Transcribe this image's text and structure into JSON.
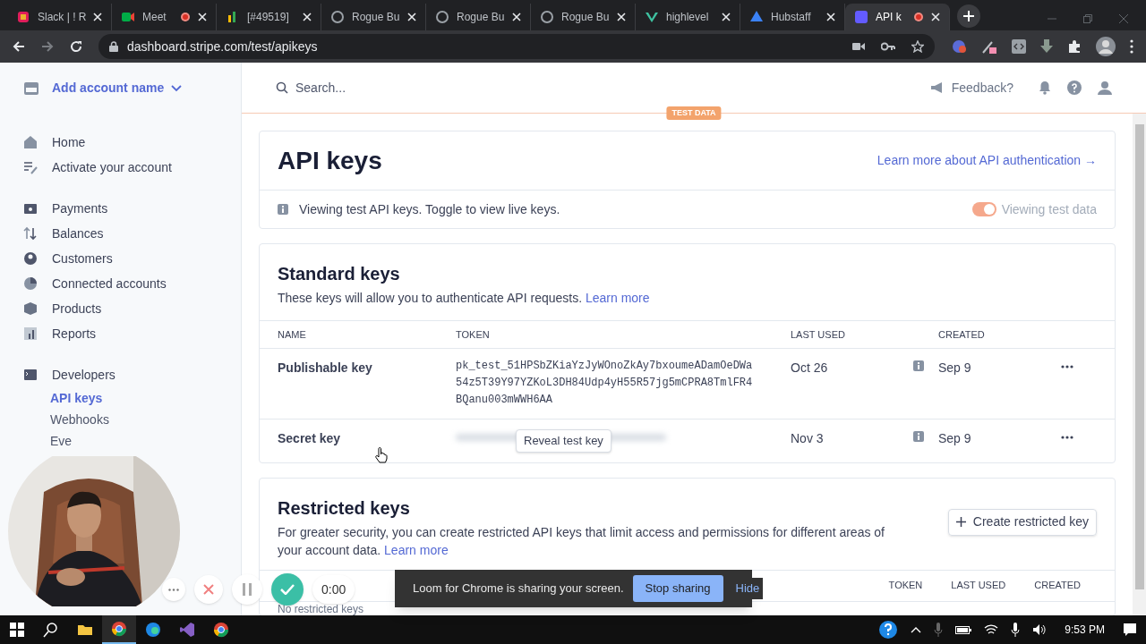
{
  "browser": {
    "tabs": [
      {
        "title": "Slack | ! R",
        "selected": false,
        "recording": false
      },
      {
        "title": "Meet",
        "selected": false,
        "recording": true
      },
      {
        "title": "[#49519]",
        "selected": false,
        "recording": false
      },
      {
        "title": "Rogue Bu",
        "selected": false,
        "recording": false
      },
      {
        "title": "Rogue Bu",
        "selected": false,
        "recording": false
      },
      {
        "title": "Rogue Bu",
        "selected": false,
        "recording": false
      },
      {
        "title": "highlevel",
        "selected": false,
        "recording": false
      },
      {
        "title": "Hubstaff",
        "selected": false,
        "recording": false
      },
      {
        "title": "API k",
        "selected": true,
        "recording": true
      }
    ],
    "url": "dashboard.stripe.com/test/apikeys"
  },
  "sidebar": {
    "account": "Add account name",
    "groups": [
      [
        {
          "label": "Home",
          "selected": false
        },
        {
          "label": "Activate your account",
          "selected": false
        }
      ],
      [
        {
          "label": "Payments",
          "selected": false
        },
        {
          "label": "Balances",
          "selected": false
        },
        {
          "label": "Customers",
          "selected": false
        },
        {
          "label": "Connected accounts",
          "selected": false
        },
        {
          "label": "Products",
          "selected": false
        },
        {
          "label": "Reports",
          "selected": false
        }
      ],
      [
        {
          "label": "Developers",
          "selected": false,
          "children": [
            {
              "label": "API keys",
              "selected": true
            },
            {
              "label": "Webhooks",
              "selected": false
            },
            {
              "label": "Eve",
              "selected": false
            }
          ]
        }
      ]
    ]
  },
  "header": {
    "search_placeholder": "Search...",
    "feedback": "Feedback?",
    "badge": "TEST DATA"
  },
  "page": {
    "title": "API keys",
    "auth_link": "Learn more about API authentication →",
    "notice": "Viewing test API keys. Toggle to view live keys.",
    "toggle": {
      "label": "Viewing test data",
      "on": true
    }
  },
  "standard_keys": {
    "title": "Standard keys",
    "description": "These keys will allow you to authenticate API requests.",
    "link": "Learn more",
    "columns": [
      "NAME",
      "TOKEN",
      "LAST USED",
      "CREATED"
    ],
    "rows": [
      {
        "kind": "visible",
        "name": "Publishable key",
        "token": "pk_test_51HPSbZKiaYzJyWOnoZkAy7bxoumeADamOeDWa54z5T39Y97YZKoL3DH84Udp4yH55R57jg5mCPRA8TmlFR4BQanu003mWWH6AA",
        "last_used": "Oct 26",
        "created": "Sep 9"
      },
      {
        "kind": "hidden",
        "name": "Secret key",
        "reveal_button": "Reveal test key",
        "last_used": "Nov 3",
        "created": "Sep 9"
      }
    ]
  },
  "restricted_keys": {
    "title": "Restricted keys",
    "description": "For greater security, you can create restricted API keys that limit access and permissions for different areas of your account data.",
    "link": "Learn more",
    "button": "Create restricted key",
    "columns": [
      "TOKEN",
      "LAST USED",
      "CREATED"
    ],
    "empty": "No restricted keys"
  },
  "loom": {
    "timer": "0:00",
    "message": "Loom for Chrome is sharing your screen.",
    "stop_button": "Stop sharing",
    "hide_button": "Hide"
  },
  "taskbar": {
    "time": "9:53 PM"
  }
}
